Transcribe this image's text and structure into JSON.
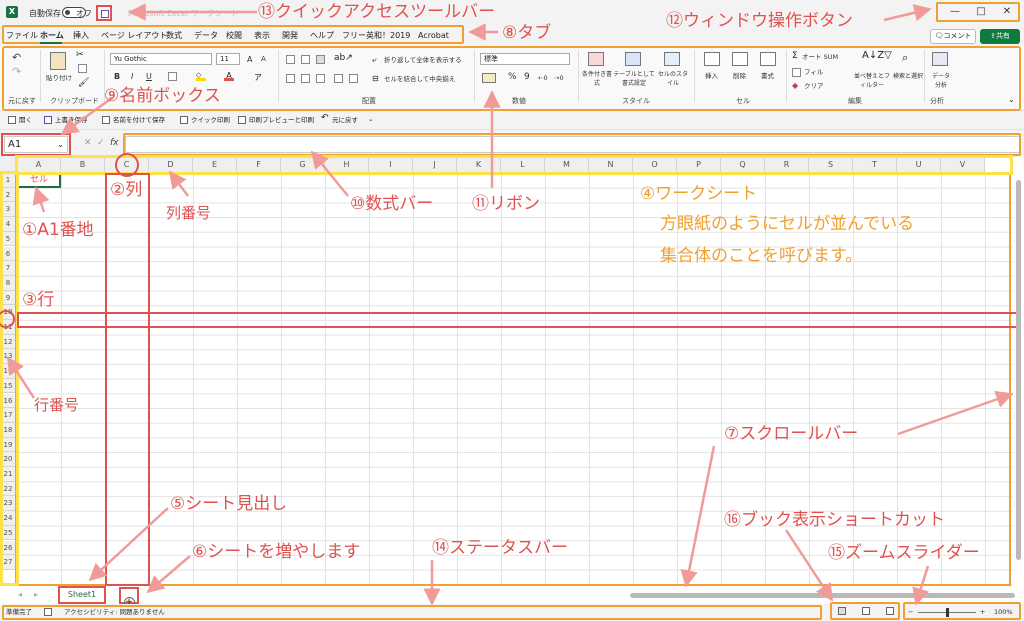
{
  "titlebar": {
    "autosave_label": "自動保存",
    "autosave_state": "オフ",
    "doc_title": "Microsoft Excel ワークシート",
    "qat_icon": "save-icon",
    "window_buttons": [
      "—",
      "□",
      "✕"
    ]
  },
  "tabs": [
    "ファイル",
    "ホーム",
    "挿入",
    "ページ レイアウト",
    "数式",
    "データ",
    "校閲",
    "表示",
    "開発",
    "ヘルプ",
    "フリー英和！2019",
    "Acrobat"
  ],
  "active_tab": "ホーム",
  "header_buttons": {
    "comment": "コメント",
    "share": "共有"
  },
  "ribbon": {
    "undo_group": {
      "label": "元に戻す"
    },
    "clipboard": {
      "paste": "貼り付け",
      "group": "クリップボード"
    },
    "font": {
      "family": "Yu Gothic",
      "size": "11",
      "bold": "B",
      "italic": "I",
      "underline": "U",
      "grow": "A",
      "shrink": "A"
    },
    "alignment": {
      "wrap": "折り返して全体を表示する",
      "merge": "セルを結合して中央揃え",
      "group": "配置"
    },
    "number": {
      "format": "標準",
      "percent": "%",
      "comma": "9",
      "group": "数値"
    },
    "styles": {
      "conditional": "条件付き書式",
      "table": "テーブルとして書式設定",
      "cell": "セルのスタイル",
      "group": "スタイル"
    },
    "cells": {
      "insert": "挿入",
      "delete": "削除",
      "format": "書式",
      "group": "セル"
    },
    "editing": {
      "autosum": "オート SUM",
      "fill": "フィル",
      "clear": "クリア",
      "sort": "並べ替えとフィルター",
      "find": "検索と選択",
      "group": "編集"
    },
    "analysis": {
      "data": "データ分析",
      "group": "分析"
    }
  },
  "qat": {
    "open": "開く",
    "overwrite": "上書き保存",
    "save_as": "名前を付けて保存",
    "quick_print": "クイック印刷",
    "print_preview": "印刷プレビューと印刷",
    "undo": "元に戻す"
  },
  "formula_bar": {
    "name_box": "A1",
    "fx": "fx",
    "cancel": "✕",
    "enter": "✓"
  },
  "columns": [
    "A",
    "B",
    "C",
    "D",
    "E",
    "F",
    "G",
    "H",
    "I",
    "J",
    "K",
    "L",
    "M",
    "N",
    "O",
    "P",
    "Q",
    "R",
    "S",
    "T",
    "U",
    "V"
  ],
  "rows": [
    "1",
    "2",
    "3",
    "4",
    "5",
    "6",
    "7",
    "8",
    "9",
    "10",
    "11",
    "12",
    "13",
    "14",
    "15",
    "16",
    "17",
    "18",
    "19",
    "20",
    "21",
    "22",
    "23",
    "24",
    "25",
    "26",
    "27"
  ],
  "cell_a1_text": "セル",
  "sheet": {
    "name": "Sheet1",
    "add": "+"
  },
  "statusbar": {
    "ready": "準備完了",
    "accessibility": "アクセシビリティ: 問題ありません",
    "zoom": "100%",
    "zoom_level": 1.0
  },
  "annotations": {
    "a1": "①A1番地",
    "col": "②列",
    "row": "③行",
    "worksheet_title": "④ワークシート",
    "worksheet_line1": "方眼紙のようにセルが並んでいる",
    "worksheet_line2": "集合体のことを呼びます。",
    "sheet_tab": "⑤シート見出し",
    "add_sheet": "⑥シートを増やします",
    "scrollbar": "⑦スクロールバー",
    "tab": "⑧タブ",
    "namebox": "⑨名前ボックス",
    "formula": "⑩数式バー",
    "ribbon": "⑪リボン",
    "window_buttons": "⑫ウィンドウ操作ボタン",
    "qat": "⑬クイックアクセスツールバー",
    "statusbar": "⑭ステータスバー",
    "zoom": "⑮ズームスライダー",
    "view_shortcuts": "⑯ブック表示ショートカット",
    "col_header": "列番号",
    "row_header": "行番号"
  },
  "colors": {
    "annotation_red": "#e0524f",
    "annotation_orange": "#f0a030",
    "highlight_yellow": "#ffe24a",
    "share_green": "#0e7a3c"
  }
}
